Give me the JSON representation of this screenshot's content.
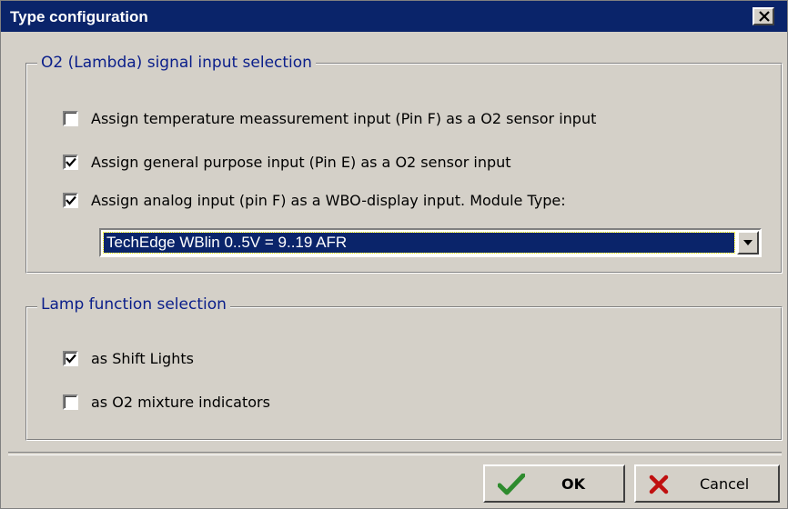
{
  "window": {
    "title": "Type configuration",
    "close_icon": "close-icon"
  },
  "o2_group": {
    "legend": "O2 (Lambda) signal input selection",
    "options": [
      {
        "label": "Assign temperature meassurement input (Pin F) as a O2 sensor input",
        "checked": false
      },
      {
        "label": "Assign general purpose input (Pin E) as a O2 sensor input",
        "checked": true
      },
      {
        "label": "Assign analog input (pin F) as a WBO-display input.   Module Type:",
        "checked": true
      }
    ],
    "module_type": {
      "selected": "TechEdge WBlin 0..5V = 9..19 AFR"
    }
  },
  "lamp_group": {
    "legend": "Lamp function selection",
    "options": [
      {
        "label": "as Shift Lights",
        "checked": true
      },
      {
        "label": "as O2 mixture indicators",
        "checked": false
      }
    ]
  },
  "buttons": {
    "ok_label": "OK",
    "cancel_label": "Cancel"
  },
  "colors": {
    "titlebar": "#0a246a",
    "legend_text": "#0a1e8a",
    "ok_check": "#2e8b2e",
    "cancel_x": "#c01010"
  }
}
